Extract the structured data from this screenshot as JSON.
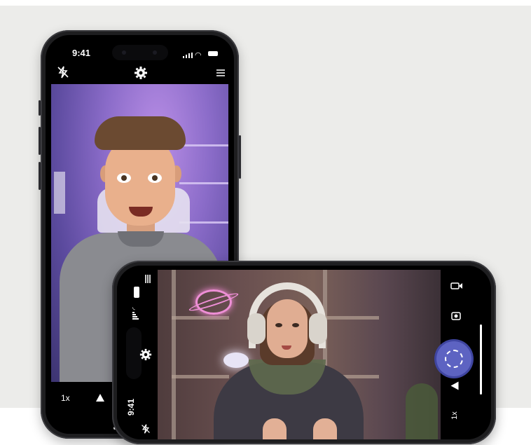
{
  "portrait_phone": {
    "status_time": "9:41",
    "zoom_label": "1x",
    "icons": [
      "flash-off-icon",
      "settings-gear-icon",
      "menu-icon",
      "flip-icon"
    ]
  },
  "landscape_phone": {
    "status_time": "9:41",
    "zoom_label": "1x",
    "icons": [
      "flash-off-icon",
      "settings-gear-icon",
      "menu-icon",
      "video-icon",
      "camera-icon",
      "shutter-icon",
      "flip-icon"
    ]
  },
  "colors": {
    "panel_bg": "#ececea",
    "shutter_accent": "#5d63c2"
  }
}
